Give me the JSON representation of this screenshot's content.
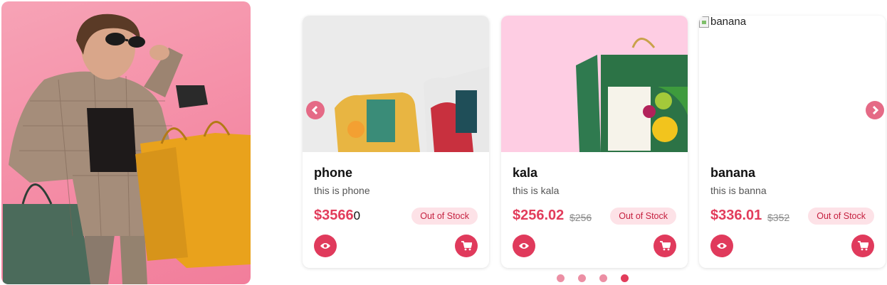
{
  "hero": {
    "image_alt": "woman with shopping bags"
  },
  "products": [
    {
      "name": "phone",
      "description": "this is phone",
      "price": "$3566",
      "price_tail": "0",
      "old_price": "",
      "stock_label": "Out of Stock"
    },
    {
      "name": "kala",
      "description": "this is kala",
      "price": "$256.02",
      "price_tail": "",
      "old_price": "$256",
      "stock_label": "Out of Stock"
    },
    {
      "name": "banana",
      "description": "this is banna",
      "price": "$336.01",
      "price_tail": "",
      "old_price": "$352",
      "stock_label": "Out of Stock",
      "image_alt": "banana"
    }
  ],
  "carousel": {
    "dots": 4,
    "active_dot": 3
  },
  "colors": {
    "accent": "#e23c5b",
    "badge_bg": "#fde2e7",
    "hero_bg": "#f48aa4"
  },
  "icons": [
    "chevron-left-icon",
    "chevron-right-icon",
    "eye-icon",
    "cart-icon"
  ]
}
